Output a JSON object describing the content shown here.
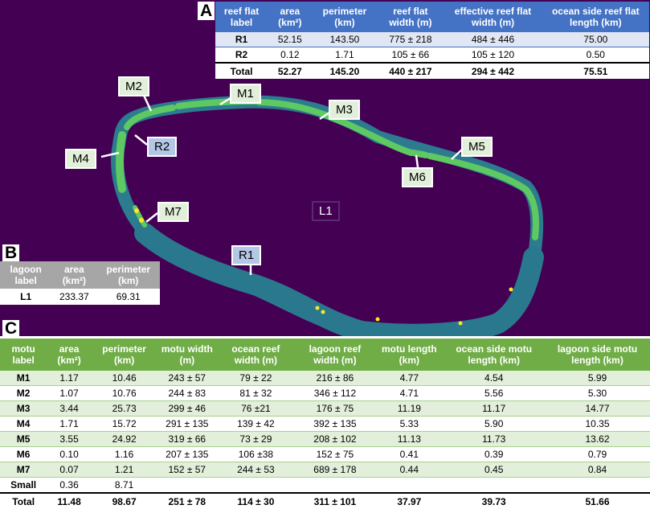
{
  "panels": {
    "a": "A",
    "b": "B",
    "c": "C"
  },
  "colors": {
    "background": "#440154",
    "reef": "#2c7b8e",
    "motu": "#5ec962",
    "motu_edge": "#21918c",
    "vegetation": "#fde725",
    "tableA_header": "#4472c4",
    "tableB_header": "#a6a6a6",
    "tableC_header": "#70ad47"
  },
  "map_labels": {
    "m1": "M1",
    "m2": "M2",
    "m3": "M3",
    "m4": "M4",
    "m5": "M5",
    "m6": "M6",
    "m7": "M7",
    "r1": "R1",
    "r2": "R2",
    "l1": "L1"
  },
  "reef_flat_table": {
    "headers": [
      "reef flat label",
      "area (km²)",
      "perimeter (km)",
      "reef flat width (m)",
      "effective reef flat width (m)",
      "ocean side reef flat length (km)"
    ],
    "rows": [
      [
        "R1",
        "52.15",
        "143.50",
        "775 ± 218",
        "484 ± 446",
        "75.00"
      ],
      [
        "R2",
        "0.12",
        "1.71",
        "105 ± 66",
        "105 ± 120",
        "0.50"
      ]
    ],
    "total": [
      "Total",
      "52.27",
      "145.20",
      "440 ± 217",
      "294 ± 442",
      "75.51"
    ]
  },
  "lagoon_table": {
    "headers": [
      "lagoon label",
      "area (km²)",
      "perimeter (km)"
    ],
    "rows": [
      [
        "L1",
        "233.37",
        "69.31"
      ]
    ]
  },
  "motu_table": {
    "headers": [
      "motu label",
      "area (km²)",
      "perimeter (km)",
      "motu width (m)",
      "ocean reef width (m)",
      "lagoon reef width (m)",
      "motu length (km)",
      "ocean side motu length (km)",
      "lagoon side motu length (km)"
    ],
    "rows": [
      [
        "M1",
        "1.17",
        "10.46",
        "243 ± 57",
        "79 ± 22",
        "216 ± 86",
        "4.77",
        "4.54",
        "5.99"
      ],
      [
        "M2",
        "1.07",
        "10.76",
        "244 ± 83",
        "81 ± 32",
        "346 ± 112",
        "4.71",
        "5.56",
        "5.30"
      ],
      [
        "M3",
        "3.44",
        "25.73",
        "299 ± 46",
        "76 ±21",
        "176 ± 75",
        "11.19",
        "11.17",
        "14.77"
      ],
      [
        "M4",
        "1.71",
        "15.72",
        "291 ± 135",
        "139 ± 42",
        "392 ± 135",
        "5.33",
        "5.90",
        "10.35"
      ],
      [
        "M5",
        "3.55",
        "24.92",
        "319 ± 66",
        "73 ± 29",
        "208 ± 102",
        "11.13",
        "11.73",
        "13.62"
      ],
      [
        "M6",
        "0.10",
        "1.16",
        "207 ± 135",
        "106 ±38",
        "152 ± 75",
        "0.41",
        "0.39",
        "0.79"
      ],
      [
        "M7",
        "0.07",
        "1.21",
        "152 ± 57",
        "244 ± 53",
        "689 ± 178",
        "0.44",
        "0.45",
        "0.84"
      ],
      [
        "Small",
        "0.36",
        "8.71",
        "",
        "",
        "",
        "",
        "",
        ""
      ]
    ],
    "total": [
      "Total",
      "11.48",
      "98.67",
      "251 ± 78",
      "114 ± 30",
      "311 ± 101",
      "37.97",
      "39.73",
      "51.66"
    ]
  }
}
